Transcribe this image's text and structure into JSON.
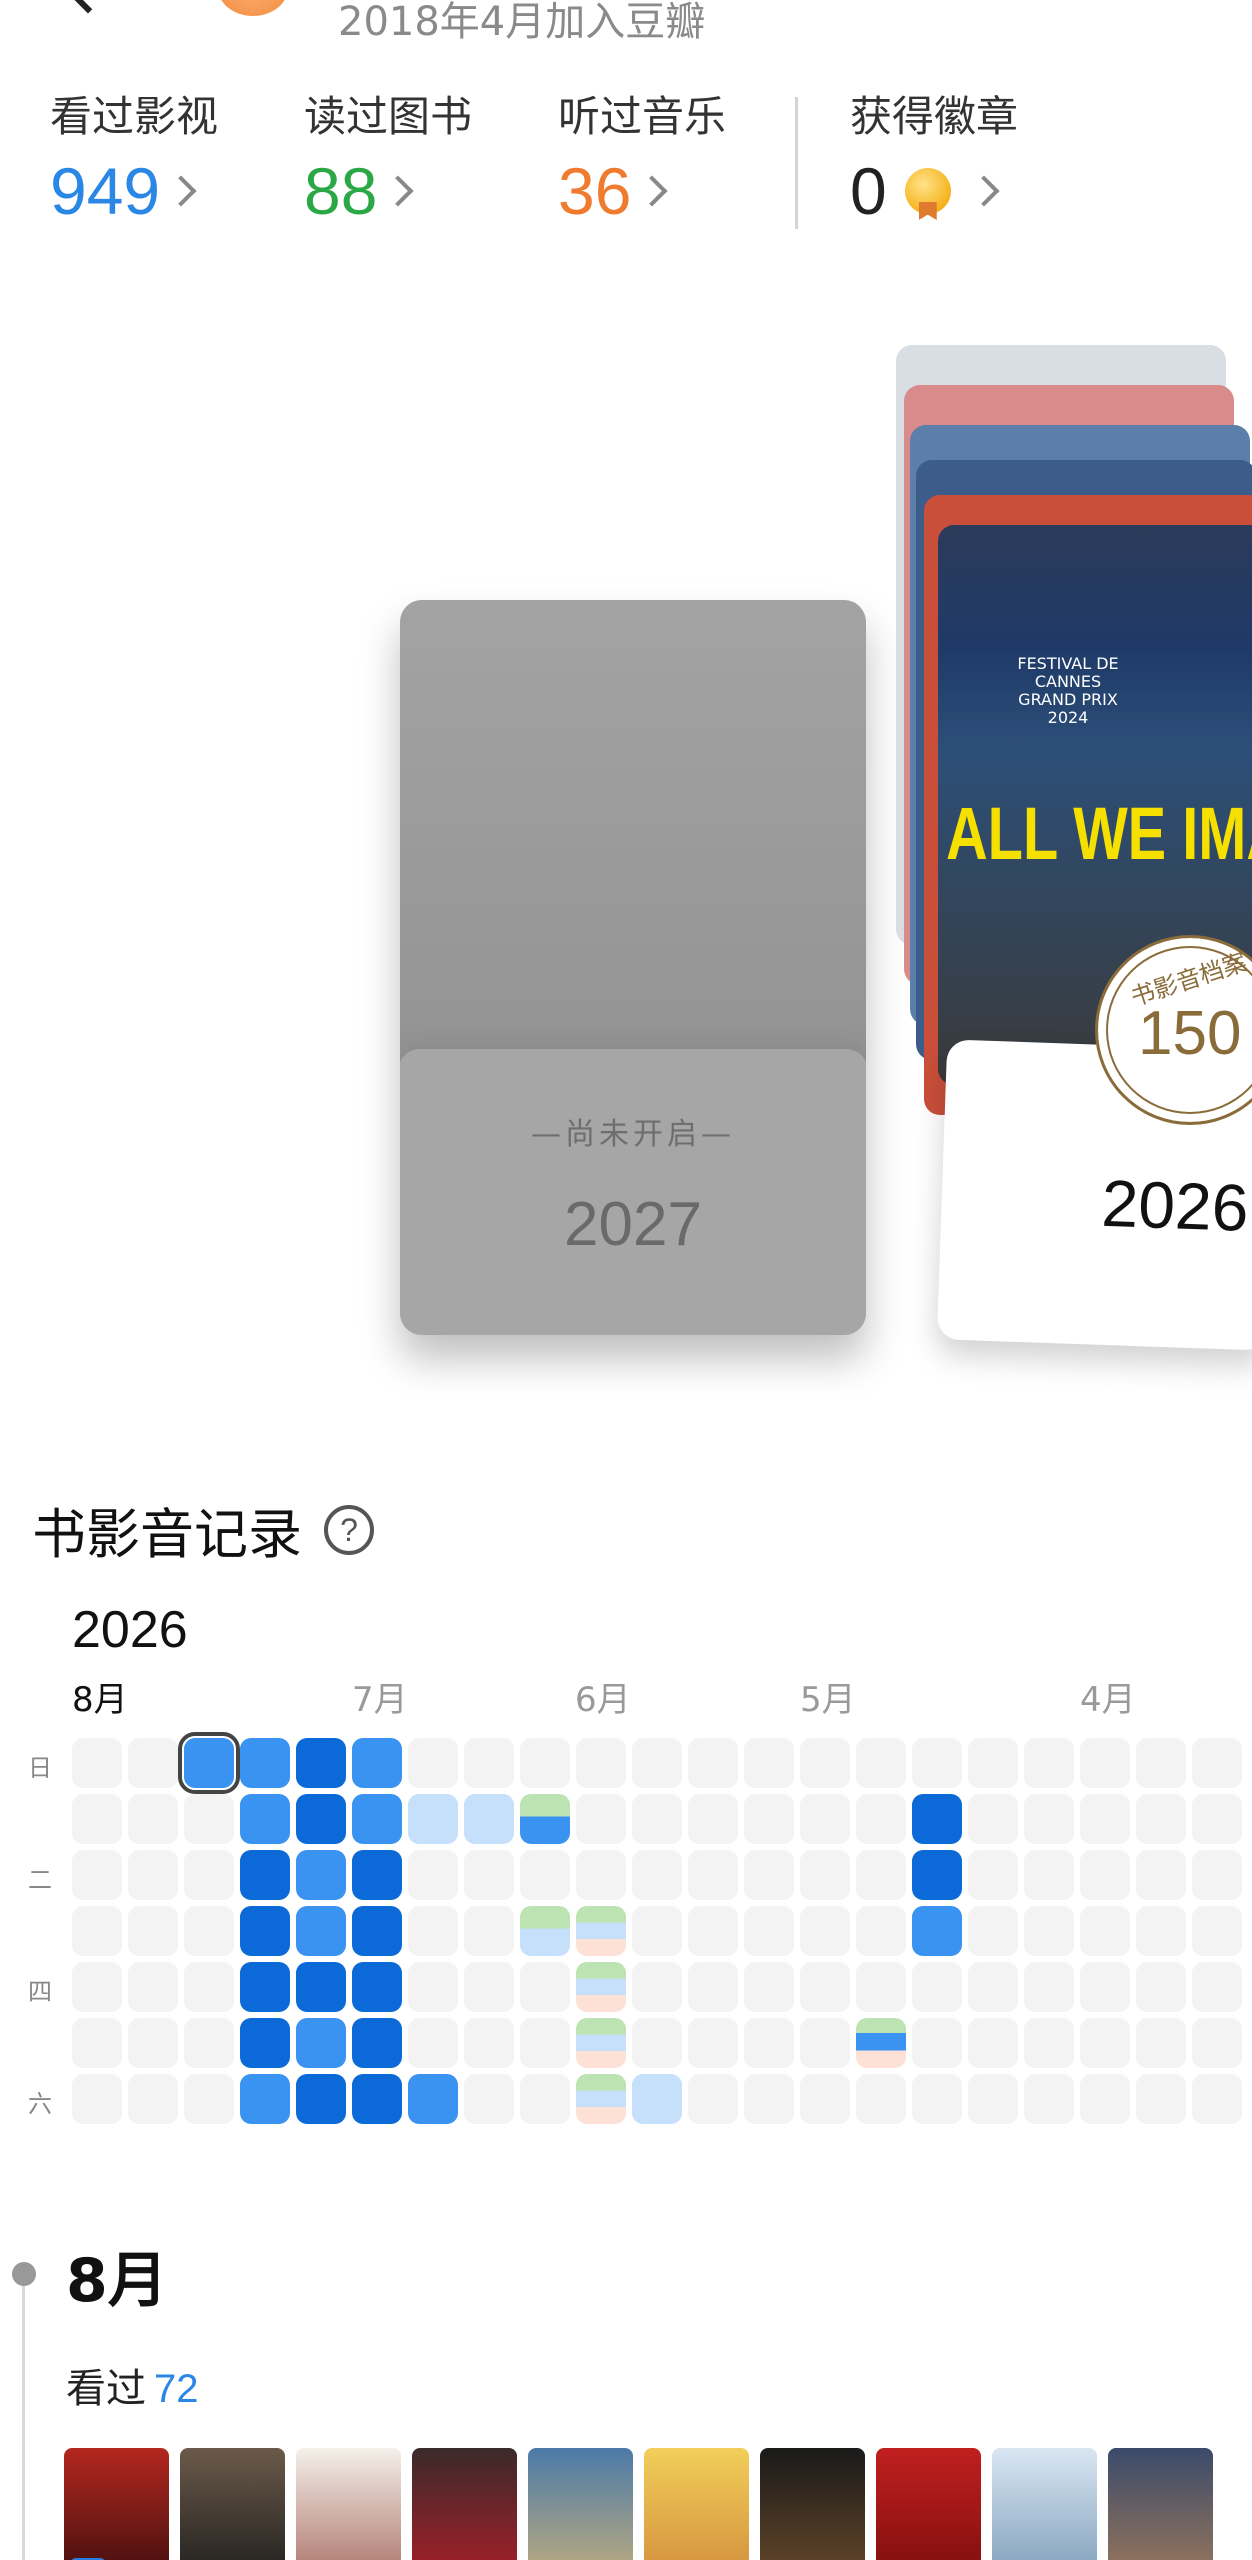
{
  "header": {
    "join_text": "2018年4月加入豆瓣"
  },
  "stats": [
    {
      "label": "看过影视",
      "value": "949",
      "color": "#2a87e6"
    },
    {
      "label": "读过图书",
      "value": "88",
      "color": "#2aa845"
    },
    {
      "label": "听过音乐",
      "value": "36",
      "color": "#f07a2e"
    },
    {
      "label": "获得徽章",
      "value": "0",
      "color": "#222222"
    }
  ],
  "locked_card": {
    "label": "—尚未开启—",
    "year": "2027"
  },
  "current_card": {
    "year": "2026",
    "seal_text": "书影音档案",
    "seal_number": "150",
    "poster_festival": "FESTIVAL DE CANNES GRAND PRIX 2024",
    "poster_title": "ALL WE IMAGINE AS LIGHT"
  },
  "records": {
    "title": "书影音记录",
    "year": "2026",
    "months": [
      "8月",
      "7月",
      "6月",
      "5月",
      "4月"
    ],
    "weekdays": [
      "日",
      "二",
      "四",
      "六"
    ]
  },
  "month_section": {
    "month": "8月",
    "watched_label": "看过",
    "watched_count": "72"
  },
  "colors": {
    "accent_blue": "#2a87e6",
    "green": "#2aa845",
    "orange": "#f07a2e"
  }
}
